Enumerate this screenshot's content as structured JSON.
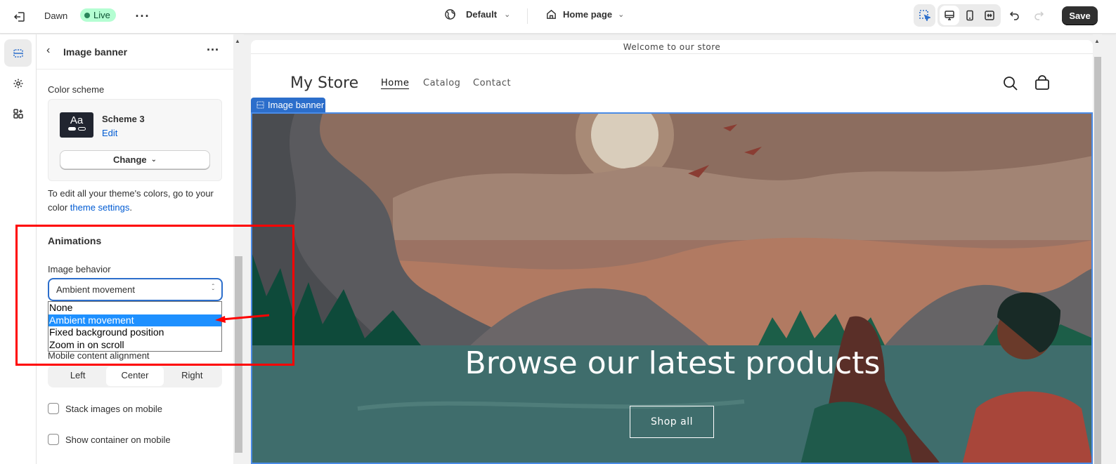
{
  "topbar": {
    "theme_name": "Dawn",
    "status_badge": "Live",
    "template_selector": "Default",
    "page_selector": "Home page",
    "save_label": "Save",
    "icons": [
      "exit-icon",
      "more-icon",
      "globe-icon",
      "home-icon",
      "inspector-icon",
      "desktop-icon",
      "mobile-icon",
      "fullwidth-icon",
      "undo-icon",
      "redo-icon"
    ]
  },
  "rail": {
    "items": [
      "sections-icon",
      "settings-icon",
      "apps-icon"
    ]
  },
  "panel": {
    "title": "Image banner",
    "color_scheme": {
      "label": "Color scheme",
      "swatch_text": "Aa",
      "scheme_name": "Scheme 3",
      "edit_label": "Edit",
      "change_label": "Change",
      "help_prefix": "To edit all your theme's colors, go to your color ",
      "help_link": "theme settings",
      "help_suffix": "."
    },
    "animations": {
      "heading": "Animations",
      "image_behavior_label": "Image behavior",
      "image_behavior_value": "Ambient movement",
      "options": [
        "None",
        "Ambient movement",
        "Fixed background position",
        "Zoom in on scroll"
      ],
      "selected_option": "Ambient movement"
    },
    "mobile_alignment": {
      "label": "Mobile content alignment",
      "options": [
        "Left",
        "Center",
        "Right"
      ],
      "selected": "Center"
    },
    "checkboxes": [
      {
        "label": "Stack images on mobile",
        "checked": false
      },
      {
        "label": "Show container on mobile",
        "checked": false
      }
    ]
  },
  "preview": {
    "announcement": "Welcome to our store",
    "store_name": "My Store",
    "nav": [
      "Home",
      "Catalog",
      "Contact"
    ],
    "active_nav": "Home",
    "section_label": "Image banner",
    "banner_heading": "Browse our latest products",
    "banner_button": "Shop all"
  },
  "colors": {
    "accent": "#2c6ecb",
    "live_badge": "#b4fed2",
    "annotation": "#ff0000",
    "dropdown_highlight": "#1e90ff"
  }
}
